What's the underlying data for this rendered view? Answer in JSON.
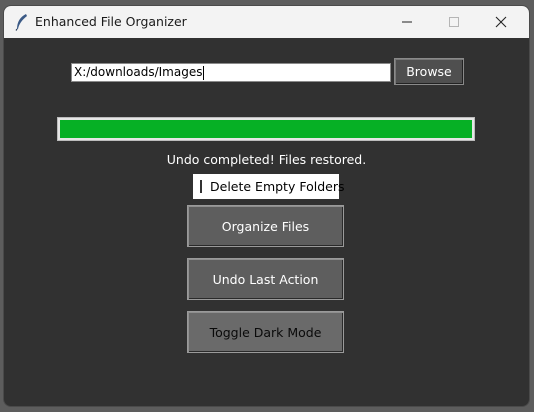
{
  "window": {
    "title": "Enhanced File Organizer"
  },
  "titlebar_icons": {
    "app": "feather-icon",
    "minimize": "minimize-icon",
    "maximize": "maximize-icon",
    "close": "close-icon"
  },
  "path_input": {
    "value": "X:/downloads/Images"
  },
  "browse_button": {
    "label": "Browse"
  },
  "progress": {
    "value_percent": 100,
    "fill_color": "#06b025"
  },
  "status": {
    "text": "Undo completed! Files restored."
  },
  "delete_empty_folders": {
    "label": "Delete Empty Folders",
    "checked": false
  },
  "buttons": {
    "organize": "Organize Files",
    "undo": "Undo Last Action",
    "toggle_dark": "Toggle Dark Mode"
  },
  "colors": {
    "window_bg": "#313131",
    "titlebar_bg": "#f3f3f3",
    "button_bg": "#5e5e5e"
  }
}
